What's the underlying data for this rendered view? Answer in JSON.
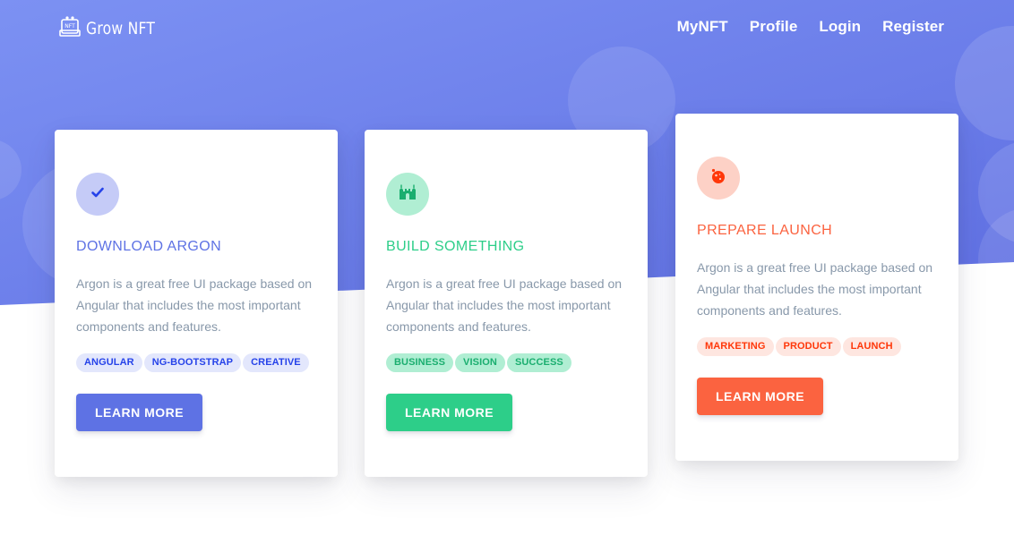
{
  "brand": {
    "name": "Grow NFT",
    "logo_icon": "nft-logo-icon"
  },
  "nav": {
    "links": [
      {
        "label": "MyNFT"
      },
      {
        "label": "Profile"
      },
      {
        "label": "Login"
      },
      {
        "label": "Register"
      }
    ]
  },
  "colors": {
    "hero_gradient_start": "#7c91f3",
    "hero_gradient_end": "#5f6fe2",
    "primary": "#5e72e4",
    "success": "#2dce89",
    "warning": "#fb6340"
  },
  "cards": [
    {
      "icon": "check-icon",
      "title": "DOWNLOAD ARGON",
      "description": "Argon is a great free UI package based on Angular that includes the most important components and features.",
      "badges": [
        "ANGULAR",
        "NG-BOOTSTRAP",
        "CREATIVE"
      ],
      "button": "LEARN MORE"
    },
    {
      "icon": "castle-icon",
      "title": "BUILD SOMETHING",
      "description": "Argon is a great free UI package based on Angular that includes the most important components and features.",
      "badges": [
        "BUSINESS",
        "VISION",
        "SUCCESS"
      ],
      "button": "LEARN MORE"
    },
    {
      "icon": "planet-icon",
      "title": "PREPARE LAUNCH",
      "description": "Argon is a great free UI package based on Angular that includes the most important components and features.",
      "badges": [
        "MARKETING",
        "PRODUCT",
        "LAUNCH"
      ],
      "button": "LEARN MORE"
    }
  ]
}
